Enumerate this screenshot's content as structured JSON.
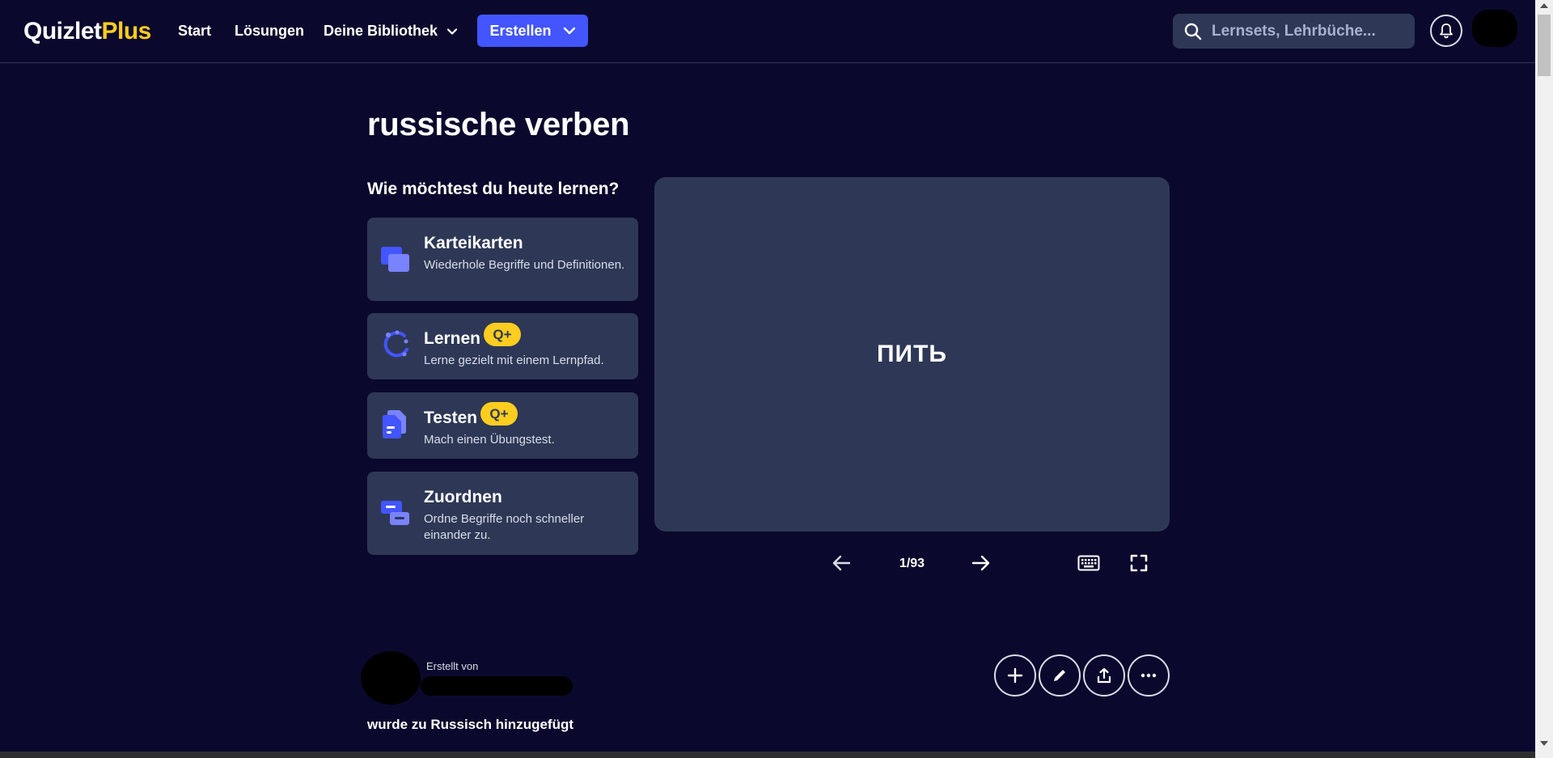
{
  "header": {
    "logo_main": "Quizlet",
    "logo_plus": "Plus",
    "nav": {
      "start": "Start",
      "loesungen": "Lösungen",
      "bibliothek": "Deine Bibliothek"
    },
    "create_label": "Erstellen",
    "search_placeholder": "Lernsets, Lehrbüche..."
  },
  "main": {
    "title": "russische verben",
    "subtitle": "Wie möchtest du heute lernen?",
    "modes": [
      {
        "name": "Karteikarten",
        "desc": "Wiederhole Begriffe und Definitionen.",
        "icon": "cards-icon",
        "plus": false
      },
      {
        "name": "Lernen",
        "desc": "Lerne gezielt mit einem Lernpfad.",
        "icon": "learn-icon",
        "plus": true,
        "badge": "Q+"
      },
      {
        "name": "Testen",
        "desc": "Mach einen Übungstest.",
        "icon": "test-icon",
        "plus": true,
        "badge": "Q+"
      },
      {
        "name": "Zuordnen",
        "desc": "Ordne Begriffe noch schneller einander zu.",
        "icon": "match-icon",
        "plus": false
      }
    ],
    "flashcard": {
      "term": "ПИТЬ",
      "counter": "1/93"
    },
    "creator": {
      "label": "Erstellt von"
    },
    "added_to": "wurde zu Russisch hinzugefügt"
  },
  "colors": {
    "background": "#0a092d",
    "card": "#2e3856",
    "accent": "#4255ff",
    "plus_badge": "#ffcd1f"
  }
}
